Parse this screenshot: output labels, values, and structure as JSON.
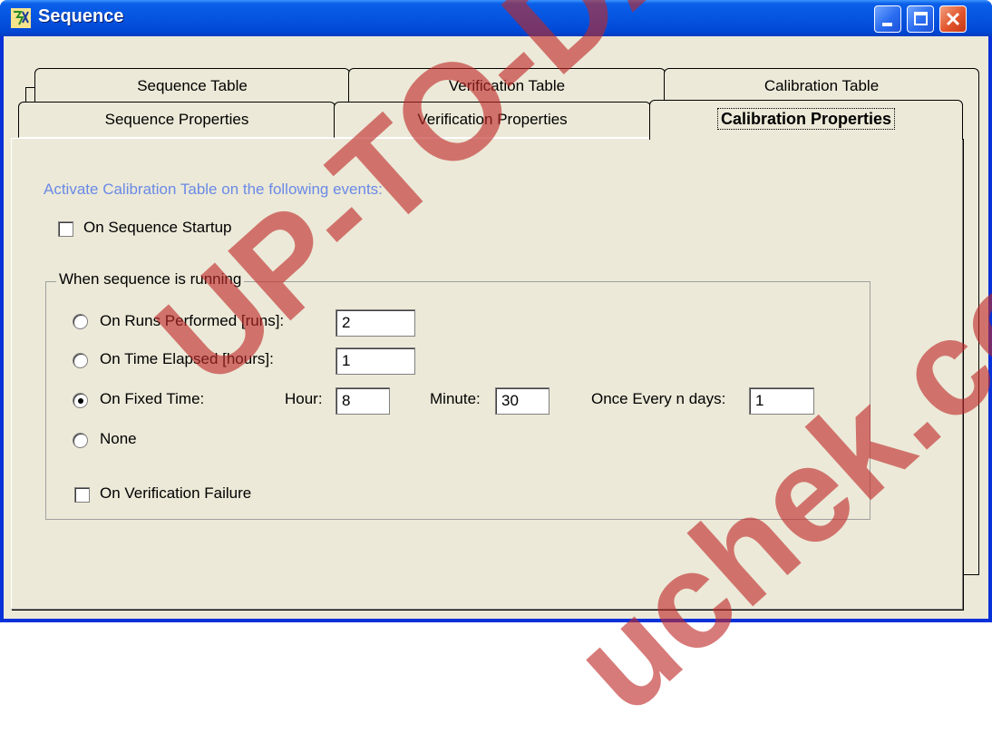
{
  "window": {
    "title": "Sequence",
    "icon": "sequence-app-icon"
  },
  "title_buttons": [
    "minimize-icon",
    "maximize-icon",
    "close-icon"
  ],
  "tabs_back": [
    "Sequence Table",
    "Verification Table",
    "Calibration Table"
  ],
  "tabs_front": [
    "Sequence Properties",
    "Verification Properties",
    "Calibration Properties"
  ],
  "active_tab": "Calibration Properties",
  "panel": {
    "heading": "Activate Calibration Table on the following events:",
    "startup_label": "On Sequence Startup",
    "startup_checked": false,
    "group_label": "When sequence is running",
    "runs_label": "On Runs Performed [runs]:",
    "runs_value": "2",
    "time_label": "On Time Elapsed [hours]:",
    "time_value": "1",
    "fixed_label": "On Fixed Time:",
    "hour_label": "Hour:",
    "hour_value": "8",
    "minute_label": "Minute:",
    "minute_value": "30",
    "days_label": "Once Every n days:",
    "days_value": "1",
    "none_label": "None",
    "selected_radio": "On Fixed Time:",
    "verification_label": "On Verification Failure",
    "verification_checked": false
  },
  "watermark": {
    "text1": "UP-TO-DATE",
    "text2": "uchek.com"
  },
  "colors": {
    "titlebar": "#0054e3",
    "face": "#ece9d8",
    "heading": "#6a8ae6",
    "watermark": "#be2828"
  }
}
